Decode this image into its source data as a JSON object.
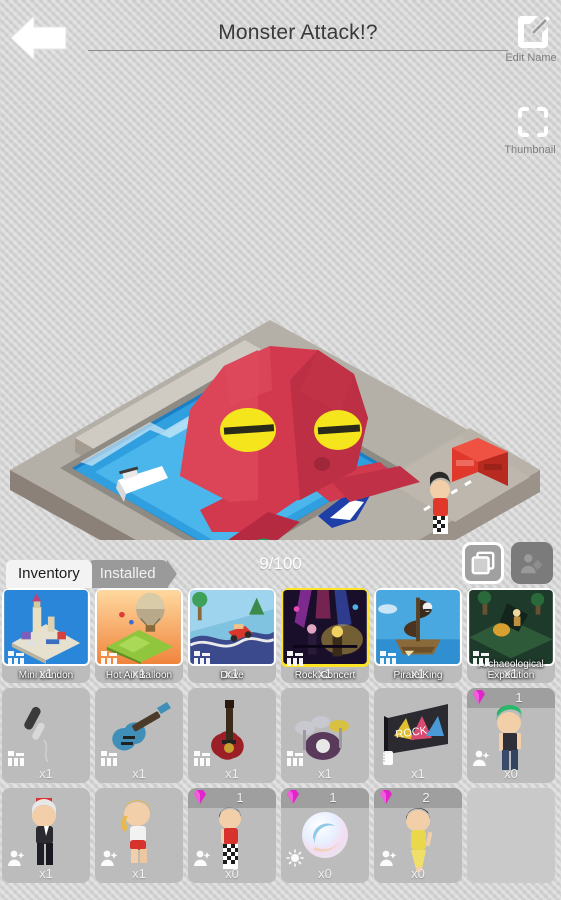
{
  "header": {
    "back_icon": "back-arrow-icon",
    "title": "Monster Attack!?",
    "edit_name_label": "Edit Name",
    "edit_name_icon": "edit-pencil-icon",
    "thumbnail_label": "Thumbnail",
    "thumbnail_icon": "crop-frame-icon"
  },
  "scene": {
    "description": "Isometric low-poly diorama: giant red octopus monster in a pool of blue water, swimmer with green hair, white boat, blue dolphin, a road with a red truck and a standing character",
    "colors": {
      "monster": "#d2394f",
      "monster_dark": "#b52a41",
      "eye": "#f5e51c",
      "water": "#2f9fe0",
      "water_light": "#56bdf0",
      "ground": "#b5b0a7",
      "road": "#b8b2a8",
      "truck": "#e0392c"
    }
  },
  "inventory": {
    "tabs": [
      {
        "label": "Inventory",
        "active": true
      },
      {
        "label": "Installed",
        "active": false
      }
    ],
    "slot_counter": "9/100",
    "mode_buttons": [
      {
        "name": "objects-mode-button",
        "icon": "stacked-squares-icon",
        "active": true
      },
      {
        "name": "characters-mode-button",
        "icon": "people-gear-icon",
        "active": false
      }
    ],
    "items": [
      {
        "name": "Mini London",
        "count": "x1",
        "kind": "scene",
        "cat_icon": "building-icon",
        "selected": false,
        "art": "mini-london"
      },
      {
        "name": "Hot Air Balloon",
        "count": "x1",
        "kind": "scene",
        "cat_icon": "building-icon",
        "selected": false,
        "art": "hot-air-balloon"
      },
      {
        "name": "Drive",
        "count": "x1",
        "kind": "scene",
        "cat_icon": "building-icon",
        "selected": false,
        "art": "drive"
      },
      {
        "name": "Rock Concert",
        "count": "x1",
        "kind": "scene",
        "cat_icon": "building-icon",
        "selected": true,
        "art": "rock-concert"
      },
      {
        "name": "Pirate King",
        "count": "x1",
        "kind": "scene",
        "cat_icon": "building-icon",
        "selected": false,
        "art": "pirate-king"
      },
      {
        "name": "Archaeological Expedition",
        "count": "x1",
        "kind": "scene",
        "cat_icon": "building-icon",
        "selected": false,
        "art": "archaeological-expedition"
      },
      {
        "name": "Microphone",
        "count": "x1",
        "kind": "object",
        "cat_icon": "building-icon",
        "art": "microphone"
      },
      {
        "name": "Blue Guitar",
        "count": "x1",
        "kind": "object",
        "cat_icon": "building-icon",
        "art": "blue-guitar"
      },
      {
        "name": "Red Guitar",
        "count": "x1",
        "kind": "object",
        "cat_icon": "building-icon",
        "art": "red-guitar"
      },
      {
        "name": "Drum Kit",
        "count": "x1",
        "kind": "object",
        "cat_icon": "building-icon",
        "art": "drum-kit"
      },
      {
        "name": "Rock Attack Poster",
        "count": "x1",
        "kind": "object",
        "cat_icon": "paper-roll-icon",
        "art": "poster"
      },
      {
        "name": "Green Hair Rocker",
        "count": "x0",
        "kind": "character",
        "cat_icon": "person-sparkle-icon",
        "gem": "1",
        "art": "green-hair-rocker"
      },
      {
        "name": "Red Hat Gentleman",
        "count": "x1",
        "kind": "character",
        "cat_icon": "person-sparkle-icon",
        "art": "red-hat-gentleman"
      },
      {
        "name": "Blonde Swimmer",
        "count": "x1",
        "kind": "character",
        "cat_icon": "person-sparkle-icon",
        "art": "blonde-swimmer"
      },
      {
        "name": "Checker Pants Rocker",
        "count": "x0",
        "kind": "character",
        "cat_icon": "person-sparkle-icon",
        "gem": "1",
        "art": "checker-rocker"
      },
      {
        "name": "Light Orb",
        "count": "x0",
        "kind": "object",
        "cat_icon": "light-bulb-icon",
        "gem": "1",
        "art": "light-orb"
      },
      {
        "name": "Yellow Dress Dancer",
        "count": "x0",
        "kind": "character",
        "cat_icon": "person-sparkle-icon",
        "gem": "2",
        "art": "yellow-dancer"
      },
      {
        "name": "",
        "count": "",
        "kind": "empty",
        "cat_icon": "",
        "art": ""
      }
    ]
  }
}
